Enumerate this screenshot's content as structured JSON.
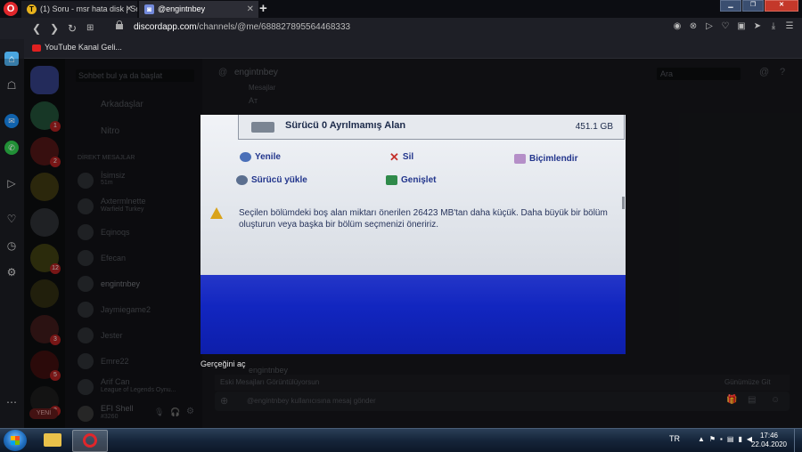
{
  "browser": {
    "tabs": [
      {
        "label": "(1) Soru - msr hata disk | Sor"
      },
      {
        "label": "@engintnbey"
      }
    ],
    "url": {
      "host": "discordapp.com",
      "path": "/channels/@me/688827895564468333"
    },
    "bookmarks": [
      {
        "label": "YouTube Kanal Geli..."
      }
    ]
  },
  "discord": {
    "search_placeholder": "Sohbet bul ya da başlat",
    "friends_label": "Arkadaşlar",
    "nitro_label": "Nitro",
    "dm_header": "DİREKT MESAJLAR",
    "dms": [
      {
        "name": "İsimsiz",
        "sub": "51m"
      },
      {
        "name": "Axtermlnette",
        "sub": "Warfield Turkey"
      },
      {
        "name": "Eqinoqs",
        "sub": ""
      },
      {
        "name": "Efecan",
        "sub": ""
      },
      {
        "name": "engintnbey",
        "sub": ""
      },
      {
        "name": "Jaymiegame2",
        "sub": ""
      },
      {
        "name": "Jester",
        "sub": ""
      },
      {
        "name": "Emre22",
        "sub": ""
      },
      {
        "name": "Arif Can",
        "sub": "League of Legends Oynu..."
      }
    ],
    "user": {
      "name": "EFI Shell",
      "tag": "#3260"
    },
    "new_badge": "YENİ",
    "chat_header": "engintnbey",
    "chat_search": "Ara",
    "chat_lines": [
      "Mesajlar",
      "Aт"
    ],
    "last_author": "engintnbey",
    "old_messages": "Eski Mesajları Görüntülüyorsun",
    "jump_present": "Günümüze Git",
    "message_placeholder": "@engintnbey kullanıcısına mesaj gönder",
    "badges": [
      "1",
      "2",
      "12",
      "3",
      "5",
      "2"
    ]
  },
  "viewer": {
    "photo": {
      "disk_label": "Sürücü 0 Ayrılmamış Alan",
      "disk_size": "451.1 GB",
      "actions": [
        {
          "label": "Yenile"
        },
        {
          "label": "Sil"
        },
        {
          "label": "Biçimlendir"
        },
        {
          "label": "Sürücü yükle"
        },
        {
          "label": "Genişlet"
        }
      ],
      "warning": "Seçilen bölümdeki boş alan miktarı önerilen 26423 MB'tan daha küçük. Daha büyük bir bölüm oluşturun veya başka bir bölüm seçmenizi öneririz."
    },
    "caption": "Gerçeğini aç"
  },
  "taskbar": {
    "lang": "TR",
    "time": "17:46",
    "date": "22.04.2020"
  }
}
